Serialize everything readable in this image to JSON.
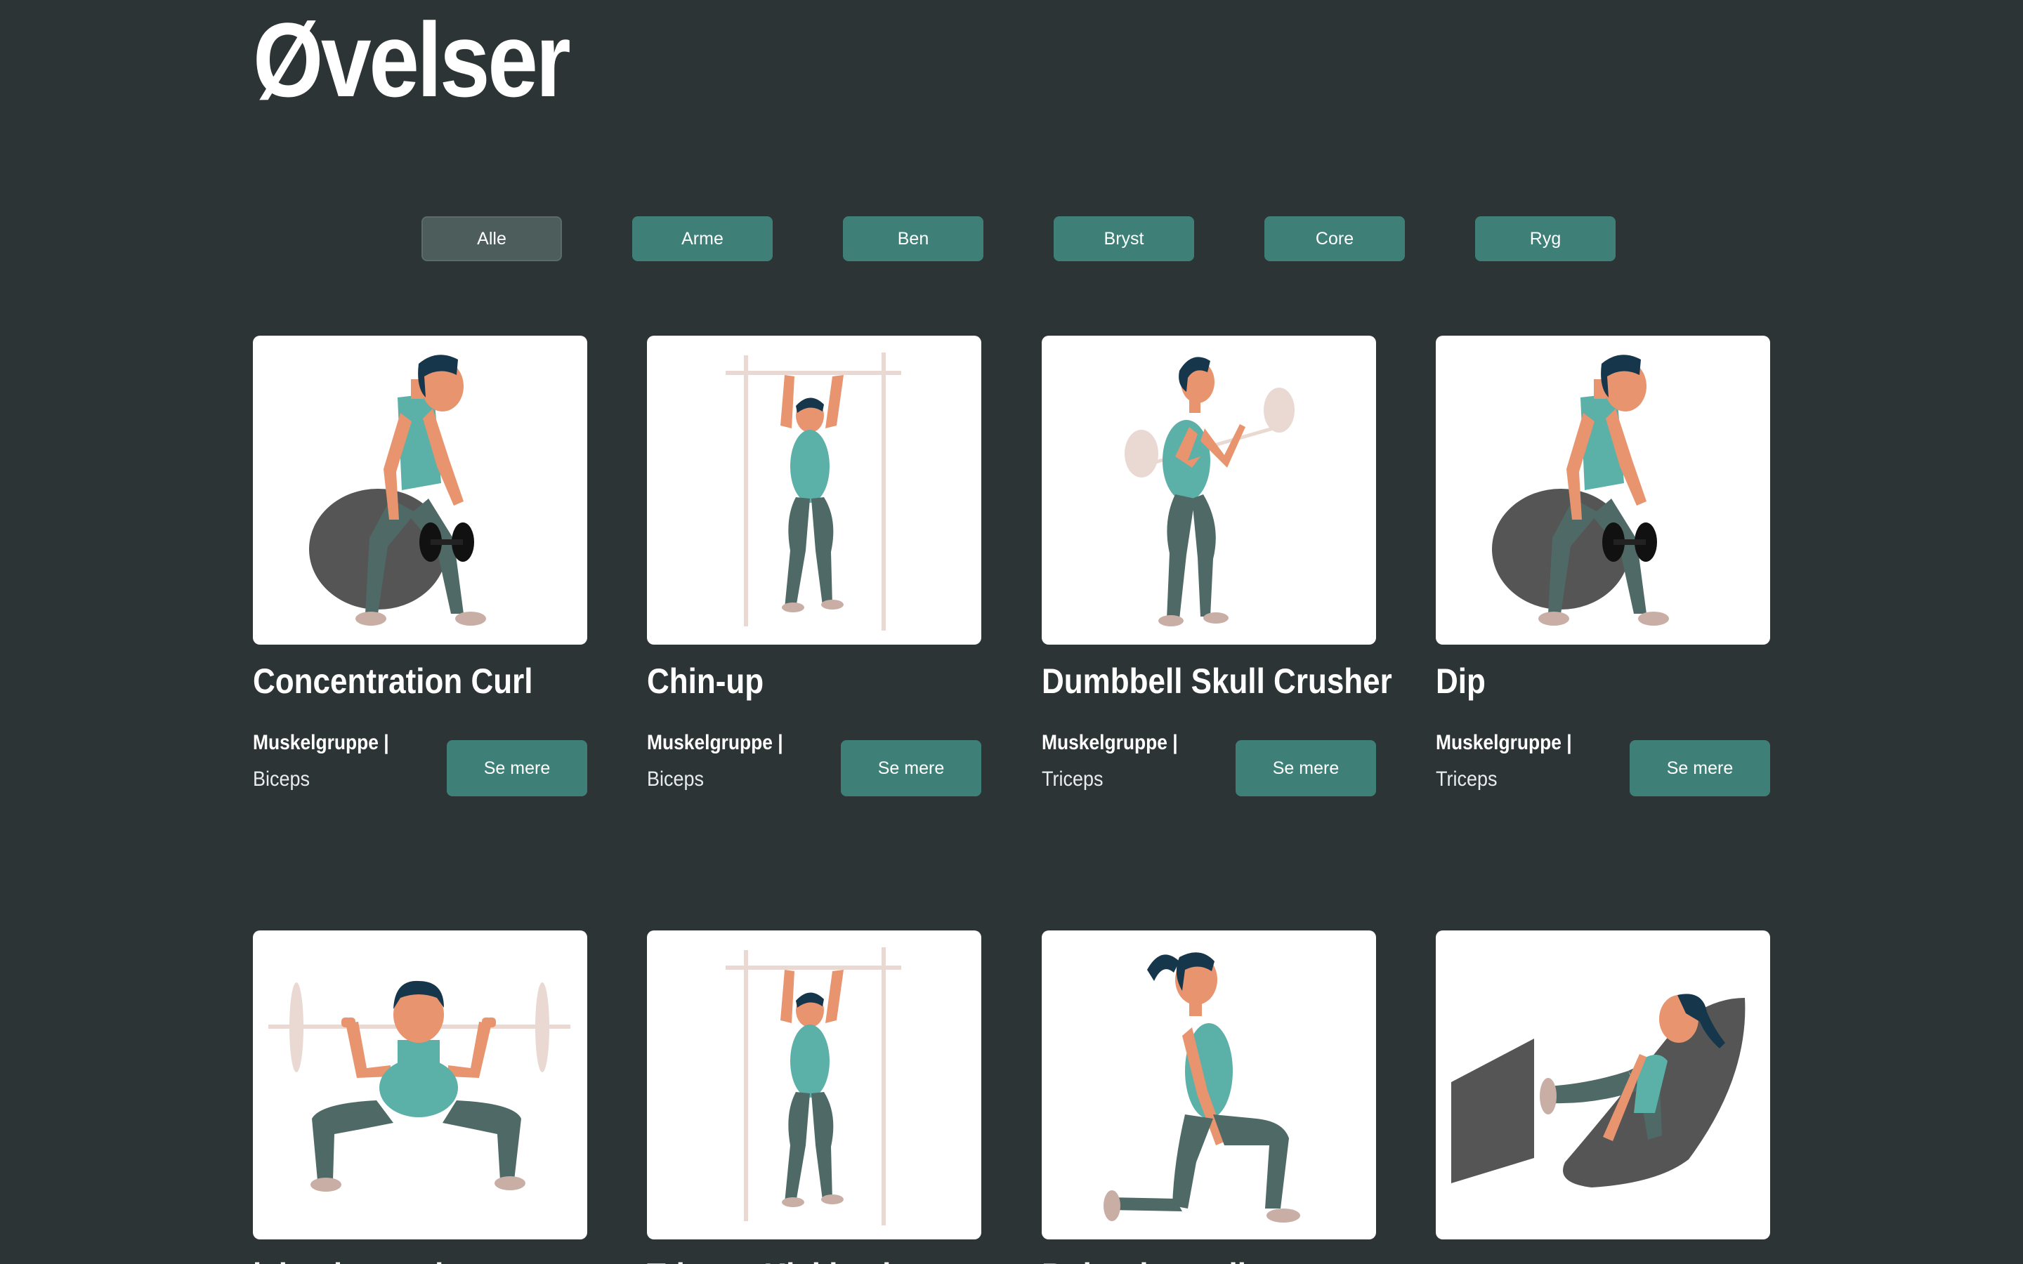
{
  "header": {
    "title": "Øvelser"
  },
  "filters": [
    {
      "label": "Alle",
      "active": true
    },
    {
      "label": "Arme",
      "active": false
    },
    {
      "label": "Ben",
      "active": false
    },
    {
      "label": "Bryst",
      "active": false
    },
    {
      "label": "Core",
      "active": false
    },
    {
      "label": "Ryg",
      "active": false
    }
  ],
  "cards_row1": [
    {
      "title": "Concentration Curl",
      "muscle_label": "Muskelgruppe |",
      "muscle": "Biceps",
      "button": "Se mere",
      "illustration": "ball-seated-dumbbell"
    },
    {
      "title": "Chin-up",
      "muscle_label": "Muskelgruppe |",
      "muscle": "Biceps",
      "button": "Se mere",
      "illustration": "pullup-bar"
    },
    {
      "title": "Dumbbell Skull Crusher",
      "muscle_label": "Muskelgruppe |",
      "muscle": "Triceps",
      "button": "Se mere",
      "illustration": "barbell-standing"
    },
    {
      "title": "Dip",
      "muscle_label": "Muskelgruppe |",
      "muscle": "Triceps",
      "button": "Se mere",
      "illustration": "ball-seated-dumbbell"
    }
  ],
  "cards_row2": [
    {
      "title": "lying leg curl",
      "illustration": "barbell-squat"
    },
    {
      "title": "Triceps Kickback",
      "illustration": "pullup-bar"
    },
    {
      "title": "Bulgarian split squat",
      "illustration": "lunge"
    },
    {
      "title": "",
      "illustration": "leg-press"
    }
  ],
  "colors": {
    "background": "#2d3435",
    "accent": "#3e8078",
    "active_filter": "#4c5d5c",
    "card": "#ffffff"
  }
}
